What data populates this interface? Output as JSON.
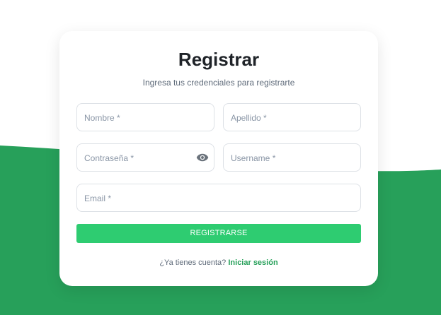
{
  "page": {
    "background_color": "#ffffff",
    "wave_color": "#27a05a"
  },
  "form": {
    "title": "Registrar",
    "subtitle": "Ingresa tus credenciales para registrarte",
    "fields": {
      "nombre": {
        "label": "Nombre *",
        "value": ""
      },
      "apellido": {
        "label": "Apellido *",
        "value": ""
      },
      "password": {
        "label": "Contraseña *",
        "value": "",
        "icon": "eye-icon"
      },
      "username": {
        "label": "Username *",
        "value": ""
      },
      "email": {
        "label": "Email *",
        "value": ""
      }
    },
    "submit_label": "REGISTRARSE",
    "submit_color": "#2ecc71",
    "footer_text": "¿Ya tienes cuenta?",
    "login_link": "Iniciar sesión",
    "link_color": "#27a05a"
  }
}
